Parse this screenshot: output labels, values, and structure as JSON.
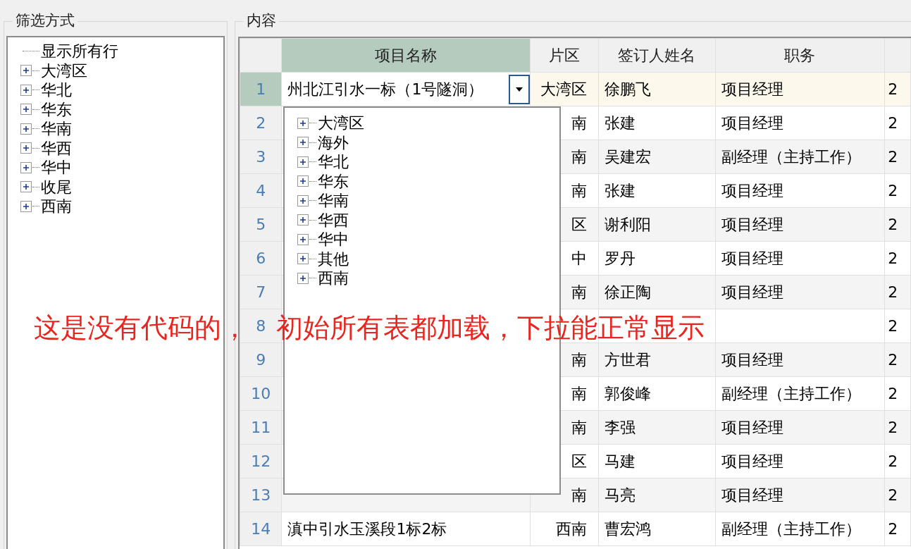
{
  "filter_group": {
    "title": "筛选方式",
    "tree": [
      {
        "label": "显示所有行",
        "kind": "leaf"
      },
      {
        "label": "大湾区",
        "kind": "node"
      },
      {
        "label": "华北",
        "kind": "node"
      },
      {
        "label": "华东",
        "kind": "node"
      },
      {
        "label": "华南",
        "kind": "node"
      },
      {
        "label": "华西",
        "kind": "node"
      },
      {
        "label": "华中",
        "kind": "node"
      },
      {
        "label": "收尾",
        "kind": "node"
      },
      {
        "label": "西南",
        "kind": "node"
      }
    ]
  },
  "content_group": {
    "title": "内容",
    "table": {
      "columns": [
        {
          "label": "项目名称",
          "selected": true
        },
        {
          "label": "片区",
          "selected": false
        },
        {
          "label": "签订人姓名",
          "selected": false
        },
        {
          "label": "职务",
          "selected": false
        }
      ],
      "rows": [
        {
          "no": "1",
          "selected": true,
          "project": "州北江引水一标（1号隧洞）",
          "region": "大湾区",
          "signer": "徐鹏飞",
          "position": "项目经理",
          "column_5": "2"
        },
        {
          "no": "2",
          "selected": false,
          "region": "南",
          "signer": "张建",
          "position": "项目经理",
          "column_5": "2"
        },
        {
          "no": "3",
          "selected": false,
          "region": "南",
          "signer": "吴建宏",
          "position": "副经理（主持工作）",
          "column_5": "2"
        },
        {
          "no": "4",
          "selected": false,
          "region": "南",
          "signer": "张建",
          "position": "项目经理",
          "column_5": "2"
        },
        {
          "no": "5",
          "selected": false,
          "region": "区",
          "signer": "谢利阳",
          "position": "项目经理",
          "column_5": "2"
        },
        {
          "no": "6",
          "selected": false,
          "region": "中",
          "signer": "罗丹",
          "position": "项目经理",
          "column_5": "2"
        },
        {
          "no": "7",
          "selected": false,
          "region": "南",
          "signer": "徐正陶",
          "position": "项目经理",
          "column_5": "2"
        },
        {
          "no": "8",
          "selected": false,
          "column_5": "2"
        },
        {
          "no": "9",
          "selected": false,
          "region": "南",
          "signer": "方世君",
          "position": "项目经理",
          "column_5": "2"
        },
        {
          "no": "10",
          "selected": false,
          "region": "南",
          "signer": "郭俊峰",
          "position": "副经理（主持工作）",
          "column_5": "2"
        },
        {
          "no": "11",
          "selected": false,
          "region": "南",
          "signer": "李强",
          "position": "项目经理",
          "column_5": "2"
        },
        {
          "no": "12",
          "selected": false,
          "region": "区",
          "signer": "马建",
          "position": "项目经理",
          "column_5": "2"
        },
        {
          "no": "13",
          "selected": false,
          "region": "南",
          "signer": "马亮",
          "position": "项目经理",
          "column_5": "2"
        },
        {
          "no": "14",
          "selected": false,
          "project": "滇中引水玉溪段1标2标",
          "region": "西南",
          "signer": "曹宏鸿",
          "position": "副经理（主持工作）",
          "column_5": "2"
        }
      ]
    },
    "dropdown_tree": [
      {
        "label": "大湾区",
        "kind": "node"
      },
      {
        "label": "海外",
        "kind": "node"
      },
      {
        "label": "华北",
        "kind": "node"
      },
      {
        "label": "华东",
        "kind": "node"
      },
      {
        "label": "华南",
        "kind": "node"
      },
      {
        "label": "华西",
        "kind": "node"
      },
      {
        "label": "华中",
        "kind": "node"
      },
      {
        "label": "其他",
        "kind": "node"
      },
      {
        "label": "西南",
        "kind": "node"
      }
    ]
  },
  "annotation": [
    "这是没有代码的",
    "，",
    "初始所有表都加载，下拉能正常显示"
  ]
}
